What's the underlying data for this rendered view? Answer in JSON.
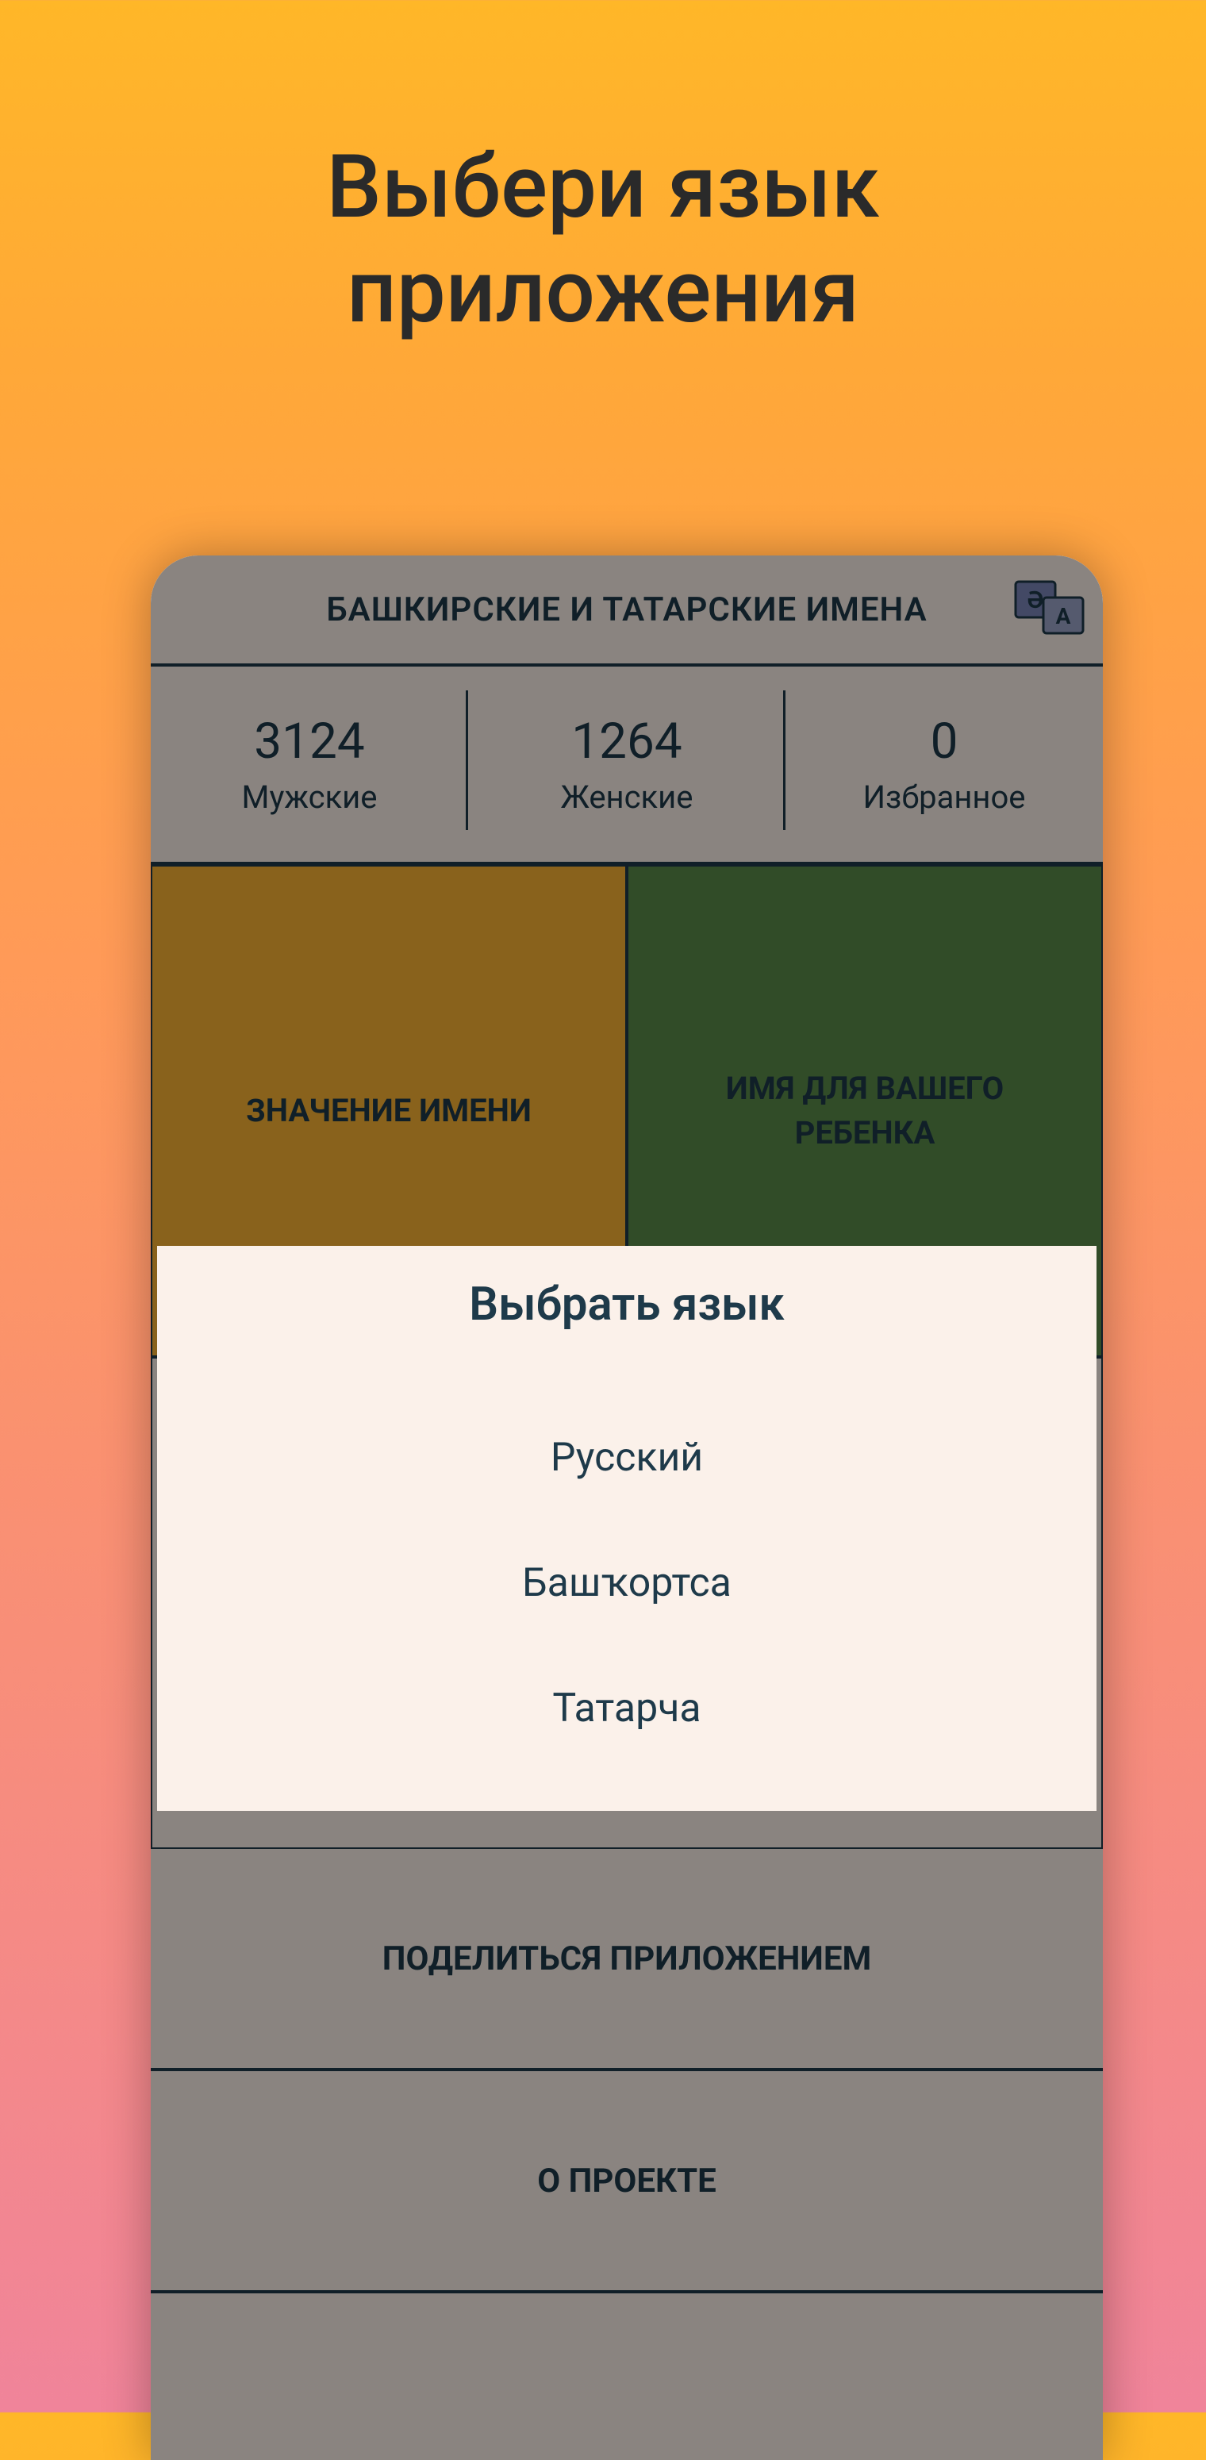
{
  "promo": {
    "title_line1": "Выбери язык",
    "title_line2": "приложения"
  },
  "header": {
    "title": "БАШКИРСКИЕ И ТАТАРСКИЕ ИМЕНА"
  },
  "stats": {
    "male": {
      "count": "3124",
      "label": "Мужские"
    },
    "female": {
      "count": "1264",
      "label": "Женские"
    },
    "favorites": {
      "count": "0",
      "label": "Избранное"
    }
  },
  "tiles": {
    "meaning": "ЗНАЧЕНИЕ ИМЕНИ",
    "child_name": "ИМЯ ДЛЯ ВАШЕГО РЕБЕНКА"
  },
  "menu": {
    "share": "ПОДЕЛИТЬСЯ ПРИЛОЖЕНИЕМ",
    "about": "О ПРОЕКТЕ"
  },
  "dialog": {
    "title": "Выбрать язык",
    "options": {
      "ru": "Русский",
      "ba": "Башҡортса",
      "tt": "Татарча"
    }
  }
}
